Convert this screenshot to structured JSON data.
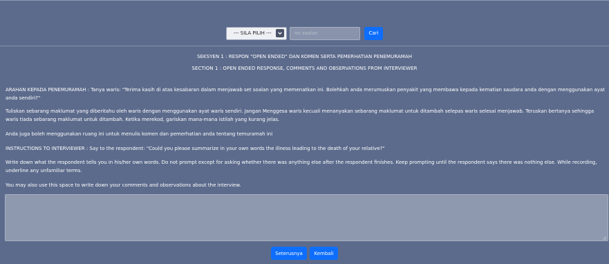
{
  "search": {
    "select_label": "--- SILA PILIH ---",
    "input_placeholder": "no soalan",
    "button_label": "Cari"
  },
  "section": {
    "title_my": "SEKSYEN 1 : RESPON \"OPEN ENDED\" DAN KOMEN SERTA PEMERHATIAN PENEMURAMAH",
    "title_en": "SECTION 1 : OPEN ENDED RESPONSE, COMMENTS AND OBSERVATIONS FROM INTERVIEWER"
  },
  "instructions": {
    "p1": "ARAHAN KEPADA PENEMURAMAH : Tanya waris: \"Terima kasih di atas kesabaran dalam menjawab set soalan yang memenatkan ini. Bolehkah anda merumuskan penyakit yang membawa kepada kematian saudara anda dengan menggunakan ayat anda sendiri?\"",
    "p2": "Tuliskan sebarang maklumat yang diberitahu oleh waris dengan menggunakan ayat waris sendiri. Jangan Menggesa waris kecuali menanyakan sebarang maklumat untuk ditambah selepas waris selesai menjawab. Teruskan bertanya sehingga waris tiada sebarang maklumat untuk ditambah. Ketika merekod, gariskan mana-mana istilah yang kurang jelas.",
    "p3": "Anda juga boleh menggunakan ruang ini untuk menulis komen dan pemerhatian anda tentang temuramah ini",
    "p4": "INSTRUCTIONS TO INTERVIEWER : Say to the respondent: \"Could you please summarize in your own words the illness leading to the death of your relative?\"",
    "p5": "Write down what the respondent tells you in his/her own words. Do not prompt except for asking whether there was anything else after the respondent finishes. Keep prompting until the respondent says there was nothing else. While recording, underline any unfamiliar terms.",
    "p6": "You may also use this space to write down your comments and observations about the interview."
  },
  "response": {
    "value": ""
  },
  "footer": {
    "next_label": "Seterusnya",
    "back_label": "Kembali"
  },
  "colors": {
    "background": "#5c6b8c",
    "primary_button": "#0d6efd",
    "textarea_bg": "#8e98ae"
  }
}
